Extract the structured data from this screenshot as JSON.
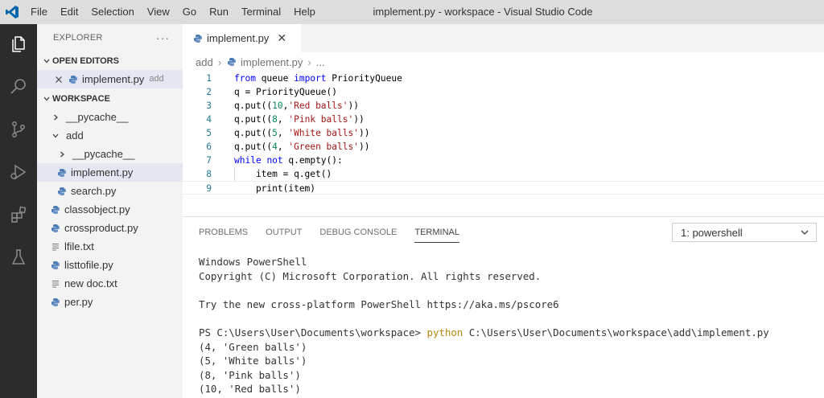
{
  "menu": [
    "File",
    "Edit",
    "Selection",
    "View",
    "Go",
    "Run",
    "Terminal",
    "Help"
  ],
  "window_title": "implement.py - workspace - Visual Studio Code",
  "activity_bar": [
    "explorer-icon",
    "search-icon",
    "source-control-icon",
    "run-debug-icon",
    "extensions-icon",
    "testing-icon"
  ],
  "explorer": {
    "title": "EXPLORER",
    "more": "···",
    "open_editors": {
      "label": "OPEN EDITORS",
      "items": [
        {
          "name": "implement.py",
          "folder": "add"
        }
      ]
    },
    "workspace": {
      "label": "WORKSPACE",
      "items": [
        {
          "name": "__pycache__",
          "type": "folder",
          "level": 1,
          "expanded": false
        },
        {
          "name": "add",
          "type": "folder",
          "level": 1,
          "expanded": true
        },
        {
          "name": "__pycache__",
          "type": "folder",
          "level": 2,
          "expanded": false
        },
        {
          "name": "implement.py",
          "type": "python",
          "level": 2,
          "selected": true
        },
        {
          "name": "search.py",
          "type": "python",
          "level": 2
        },
        {
          "name": "classobject.py",
          "type": "python",
          "level": 1
        },
        {
          "name": "crossproduct.py",
          "type": "python",
          "level": 1
        },
        {
          "name": "lfile.txt",
          "type": "text",
          "level": 1
        },
        {
          "name": "listtofile.py",
          "type": "python",
          "level": 1
        },
        {
          "name": "new doc.txt",
          "type": "text",
          "level": 1
        },
        {
          "name": "per.py",
          "type": "python",
          "level": 1
        }
      ]
    }
  },
  "editor": {
    "tab_label": "implement.py",
    "tab_close": "✕",
    "breadcrumb": [
      "add",
      "implement.py",
      "..."
    ],
    "lines": [
      {
        "n": "1",
        "code": "from queue import PriorityQueue"
      },
      {
        "n": "2",
        "code": "q = PriorityQueue()"
      },
      {
        "n": "3",
        "code": "q.put((10,'Red balls'))"
      },
      {
        "n": "4",
        "code": "q.put((8, 'Pink balls'))"
      },
      {
        "n": "5",
        "code": "q.put((5, 'White balls'))"
      },
      {
        "n": "6",
        "code": "q.put((4, 'Green balls'))"
      },
      {
        "n": "7",
        "code": "while not q.empty():"
      },
      {
        "n": "8",
        "code": "    item = q.get()"
      },
      {
        "n": "9",
        "code": "    print(item)"
      }
    ]
  },
  "panel": {
    "tabs": [
      "PROBLEMS",
      "OUTPUT",
      "DEBUG CONSOLE",
      "TERMINAL"
    ],
    "active_tab": "TERMINAL",
    "terminal_select": "1: powershell",
    "terminal_lines": [
      "Windows PowerShell",
      "Copyright (C) Microsoft Corporation. All rights reserved.",
      "",
      "Try the new cross-platform PowerShell https://aka.ms/pscore6",
      "",
      "PS C:\\Users\\User\\Documents\\workspace> python C:\\Users\\User\\Documents\\workspace\\add\\implement.py",
      "(4, 'Green balls')",
      "(5, 'White balls')",
      "(8, 'Pink balls')",
      "(10, 'Red balls')"
    ]
  },
  "colors": {
    "titlebar": "#dddddd",
    "activity_bar": "#2c2c2c",
    "sidebar": "#f3f3f3",
    "keyword": "#0000ff",
    "string": "#a31515",
    "number": "#098658",
    "python_icon": "#4b7bb5"
  }
}
